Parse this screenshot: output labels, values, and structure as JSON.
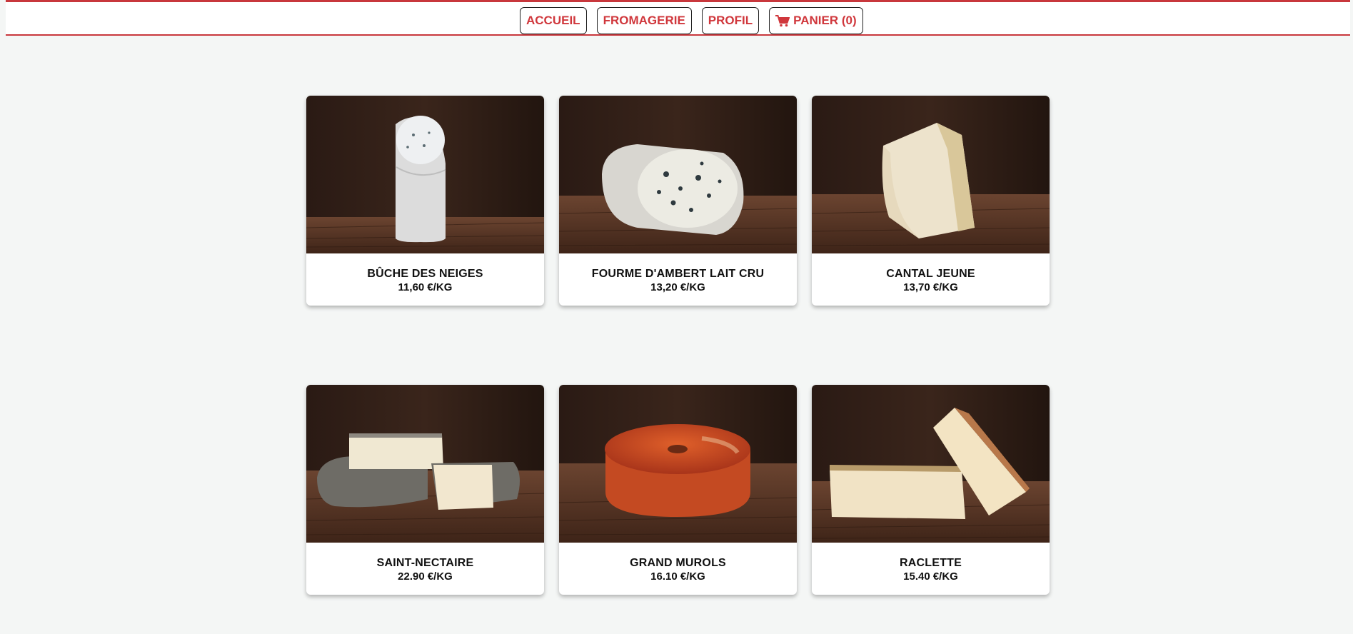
{
  "nav": {
    "home": "ACCUEIL",
    "shop": "FROMAGERIE",
    "profile": "PROFIL",
    "cart": "PANIER (0)",
    "cart_icon": "shopping-cart-icon",
    "accent_color": "#d0373c"
  },
  "products": [
    {
      "name": "BÛCHE DES NEIGES",
      "price": "11,60 €/KG"
    },
    {
      "name": "FOURME D'AMBERT LAIT CRU",
      "price": "13,20 €/KG"
    },
    {
      "name": "CANTAL JEUNE",
      "price": "13,70 €/KG"
    },
    {
      "name": "SAINT-NECTAIRE",
      "price": "22.90 €/KG"
    },
    {
      "name": "GRAND MUROLS",
      "price": "16.10 €/KG"
    },
    {
      "name": "RACLETTE",
      "price": "15.40 €/KG"
    }
  ]
}
